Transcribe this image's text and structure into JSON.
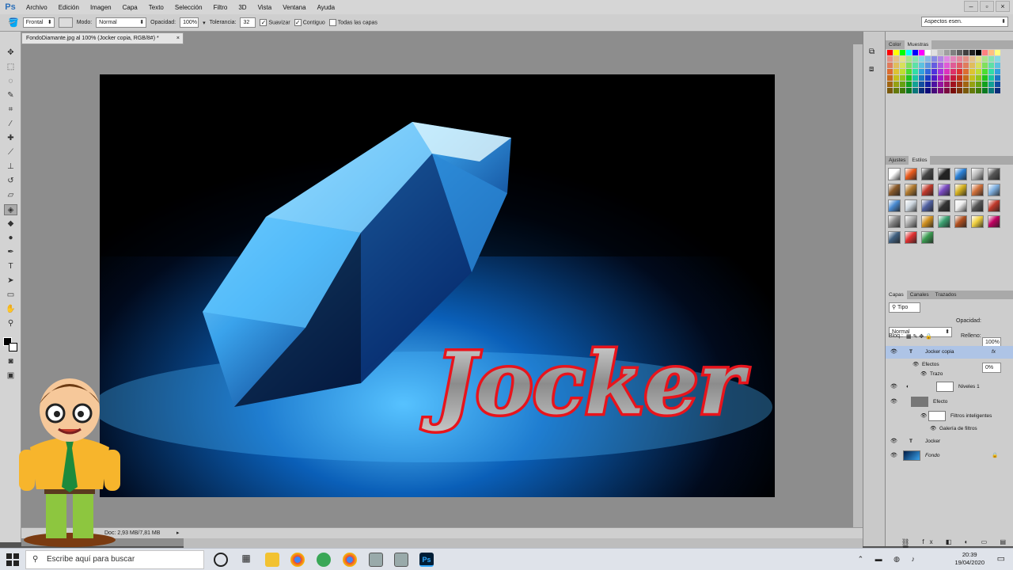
{
  "app": {
    "logo": "Ps"
  },
  "menubar": [
    "Archivo",
    "Edición",
    "Imagen",
    "Capa",
    "Texto",
    "Selección",
    "Filtro",
    "3D",
    "Vista",
    "Ventana",
    "Ayuda"
  ],
  "window_controls": [
    "–",
    "▫",
    "×"
  ],
  "options": {
    "fill_source": "Frontal",
    "mode_label": "Modo:",
    "mode_value": "Normal",
    "opacity_label": "Opacidad:",
    "opacity_value": "100%",
    "tolerance_label": "Tolerancia:",
    "tolerance_value": "32",
    "smooth_label": "Suavizar",
    "contiguous_label": "Contiguo",
    "all_layers_label": "Todas las capas",
    "workspace": "Aspectos esen."
  },
  "document": {
    "tab_title": "FondoDiamante.jpg al 100% (Jocker copia, RGB/8#) *",
    "artwork_text": "Jocker",
    "status": "Doc: 2,93 MB/7,81 MB"
  },
  "color_panel": {
    "tabs": [
      "Color",
      "Muestras"
    ],
    "active": "Muestras"
  },
  "styles_panel": {
    "tabs": [
      "Ajustes",
      "Estilos"
    ],
    "active": "Estilos"
  },
  "layers_panel": {
    "tabs": [
      "Capas",
      "Canales",
      "Trazados"
    ],
    "filter": "Tipo",
    "blend_mode": "Normal",
    "opacity_label": "Opacidad:",
    "opacity_value": "100%",
    "lock_label": "Bloq.:",
    "fill_label": "Relleno:",
    "fill_value": "0%",
    "layers": [
      {
        "name": "Jocker copia",
        "kind": "text",
        "selected": true,
        "fx": "fx"
      },
      {
        "name": "Efectos",
        "kind": "sub"
      },
      {
        "name": "Trazo",
        "kind": "subsub"
      },
      {
        "name": "Niveles 1",
        "kind": "adjust"
      },
      {
        "name": "Efecto",
        "kind": "smart"
      },
      {
        "name": "Filtros inteligentes",
        "kind": "sub"
      },
      {
        "name": "Galería de filtros",
        "kind": "subsub"
      },
      {
        "name": "Jocker",
        "kind": "text"
      },
      {
        "name": "Fondo",
        "kind": "image"
      }
    ]
  },
  "taskbar": {
    "search_placeholder": "Escribe aquí para buscar",
    "time": "20:39",
    "date": "19/04/2020"
  },
  "colors": {
    "accent_selection": "#aec4e6",
    "artwork_text_outline": "#e8141c",
    "ps_blue": "#2c6fb8"
  }
}
